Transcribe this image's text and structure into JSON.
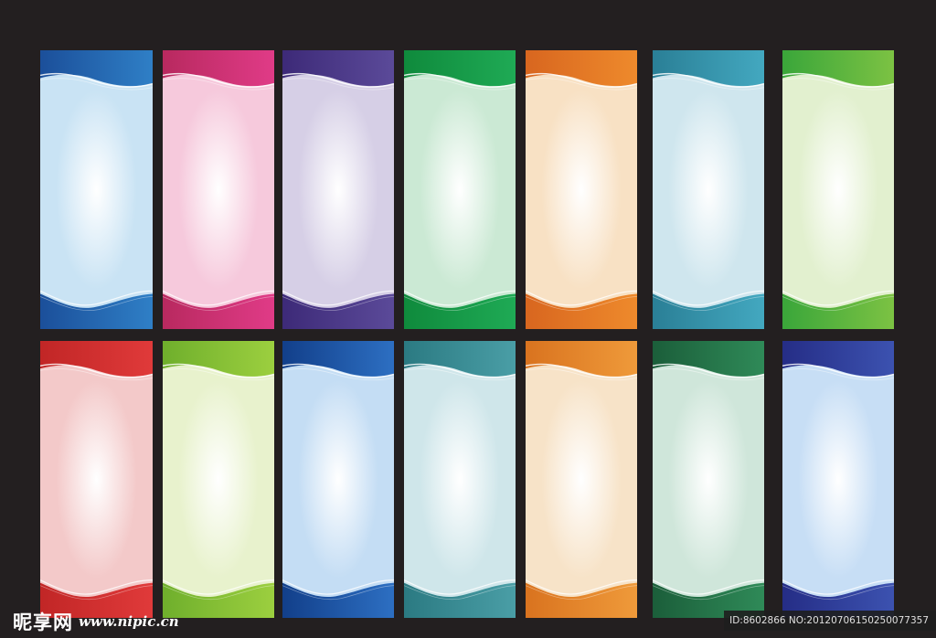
{
  "panels": [
    {
      "name": "blue",
      "dark": "#1b4f9a",
      "mid": "#2f7fc6",
      "light": "#c9e3f4"
    },
    {
      "name": "magenta",
      "dark": "#b8295f",
      "mid": "#e03b87",
      "light": "#f6c9dc"
    },
    {
      "name": "purple",
      "dark": "#3d2a78",
      "mid": "#5b4a99",
      "light": "#d6cfe6"
    },
    {
      "name": "green",
      "dark": "#0f8a3c",
      "mid": "#1faa55",
      "light": "#cbe9d4"
    },
    {
      "name": "orange",
      "dark": "#d8661f",
      "mid": "#ee8a2c",
      "light": "#f8e1c4"
    },
    {
      "name": "teal",
      "dark": "#2a7f96",
      "mid": "#43a8c0",
      "light": "#cfe6ee"
    },
    {
      "name": "lime",
      "dark": "#3aa63a",
      "mid": "#7cc243",
      "light": "#e2f0cf"
    },
    {
      "name": "red",
      "dark": "#c12626",
      "mid": "#e03a3a",
      "light": "#f3c9c9"
    },
    {
      "name": "yellow-green",
      "dark": "#6faf2c",
      "mid": "#9ccf3f",
      "light": "#e8f2cd"
    },
    {
      "name": "navy-blue",
      "dark": "#123f8a",
      "mid": "#2d6fc2",
      "light": "#c4ddf4"
    },
    {
      "name": "dark-teal",
      "dark": "#2b7a82",
      "mid": "#4a9ea6",
      "light": "#cfe6ea"
    },
    {
      "name": "amber",
      "dark": "#d9731f",
      "mid": "#ef9a3a",
      "light": "#f7e3c8"
    },
    {
      "name": "forest-green",
      "dark": "#1b5e3a",
      "mid": "#2f8a58",
      "light": "#cfe6da"
    },
    {
      "name": "indigo",
      "dark": "#252d86",
      "mid": "#3c52b0",
      "light": "#c7def5"
    }
  ],
  "watermark": {
    "brand": "昵享网",
    "site": "www.nipic.cn",
    "id_text": "ID:8602866 NO:20120706150250077357"
  }
}
